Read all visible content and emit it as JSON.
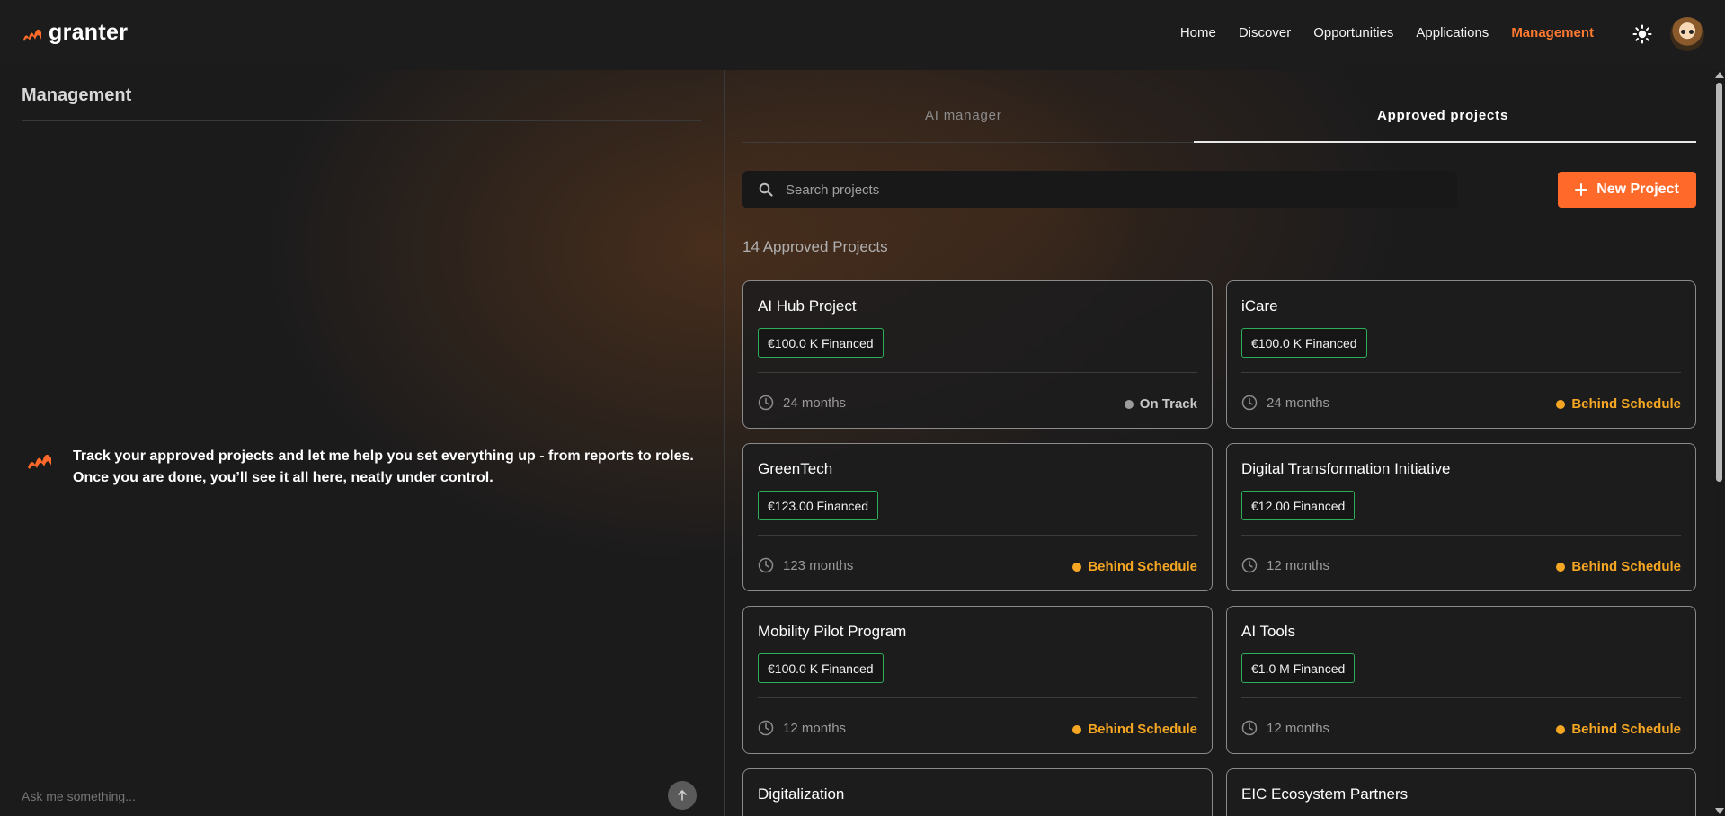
{
  "app": {
    "name": "granter"
  },
  "nav": {
    "items": [
      "Home",
      "Discover",
      "Opportunities",
      "Applications",
      "Management"
    ],
    "active": "Management"
  },
  "left": {
    "title": "Management",
    "message_line1": "Track your approved projects and let me help you set everything up - from reports to roles.",
    "message_line2": "Once you are done, you’ll see it all here, neatly under control.",
    "input_placeholder": "Ask me something..."
  },
  "tabs": {
    "ai_manager": "AI manager",
    "approved": "Approved projects",
    "active": "approved"
  },
  "search": {
    "placeholder": "Search projects"
  },
  "new_project_label": "New Project",
  "count_label": "14 Approved Projects",
  "colors": {
    "accent": "#ff6a2a",
    "nav_active": "#ff7a2f",
    "badge_border": "#2fae5a",
    "behind": "#f5a623",
    "on_track": "#9c9c9c"
  },
  "projects": [
    {
      "name": "AI Hub Project",
      "financed": "€100.0 K Financed",
      "duration": "24 months",
      "status": "On Track",
      "status_type": "track"
    },
    {
      "name": "iCare",
      "financed": "€100.0 K Financed",
      "duration": "24 months",
      "status": "Behind Schedule",
      "status_type": "behind"
    },
    {
      "name": "GreenTech",
      "financed": "€123.00 Financed",
      "duration": "123 months",
      "status": "Behind Schedule",
      "status_type": "behind"
    },
    {
      "name": "Digital Transformation Initiative",
      "financed": "€12.00 Financed",
      "duration": "12 months",
      "status": "Behind Schedule",
      "status_type": "behind"
    },
    {
      "name": "Mobility Pilot Program",
      "financed": "€100.0 K Financed",
      "duration": "12 months",
      "status": "Behind Schedule",
      "status_type": "behind"
    },
    {
      "name": "AI Tools",
      "financed": "€1.0 M Financed",
      "duration": "12 months",
      "status": "Behind Schedule",
      "status_type": "behind"
    },
    {
      "name": "Digitalization"
    },
    {
      "name": "EIC Ecosystem Partners"
    }
  ]
}
